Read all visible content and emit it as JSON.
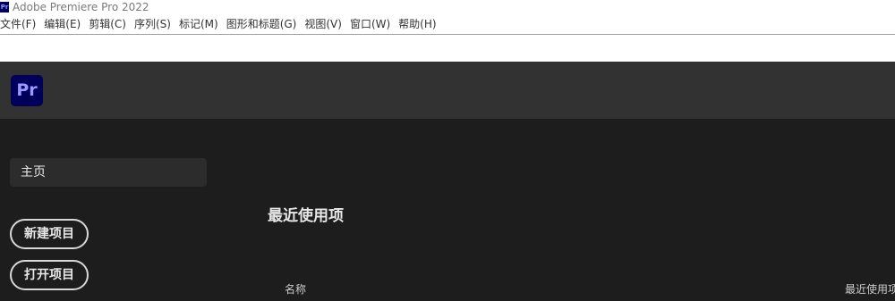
{
  "window": {
    "icon_text": "Pr",
    "title": "Adobe Premiere Pro 2022"
  },
  "menubar": {
    "items": [
      {
        "label": "文件(F)"
      },
      {
        "label": "编辑(E)"
      },
      {
        "label": "剪辑(C)"
      },
      {
        "label": "序列(S)"
      },
      {
        "label": "标记(M)"
      },
      {
        "label": "图形和标题(G)"
      },
      {
        "label": "视图(V)"
      },
      {
        "label": "窗口(W)"
      },
      {
        "label": "帮助(H)"
      }
    ]
  },
  "header": {
    "logo_text": "Pr",
    "logo_color": "#00005b",
    "logo_text_color": "#9999ff"
  },
  "sidebar": {
    "home_label": "主页",
    "new_project_label": "新建项目",
    "open_project_label": "打开项目"
  },
  "recent": {
    "title": "最近使用项",
    "columns": {
      "name": "名称",
      "recent": "最近使用项"
    }
  }
}
